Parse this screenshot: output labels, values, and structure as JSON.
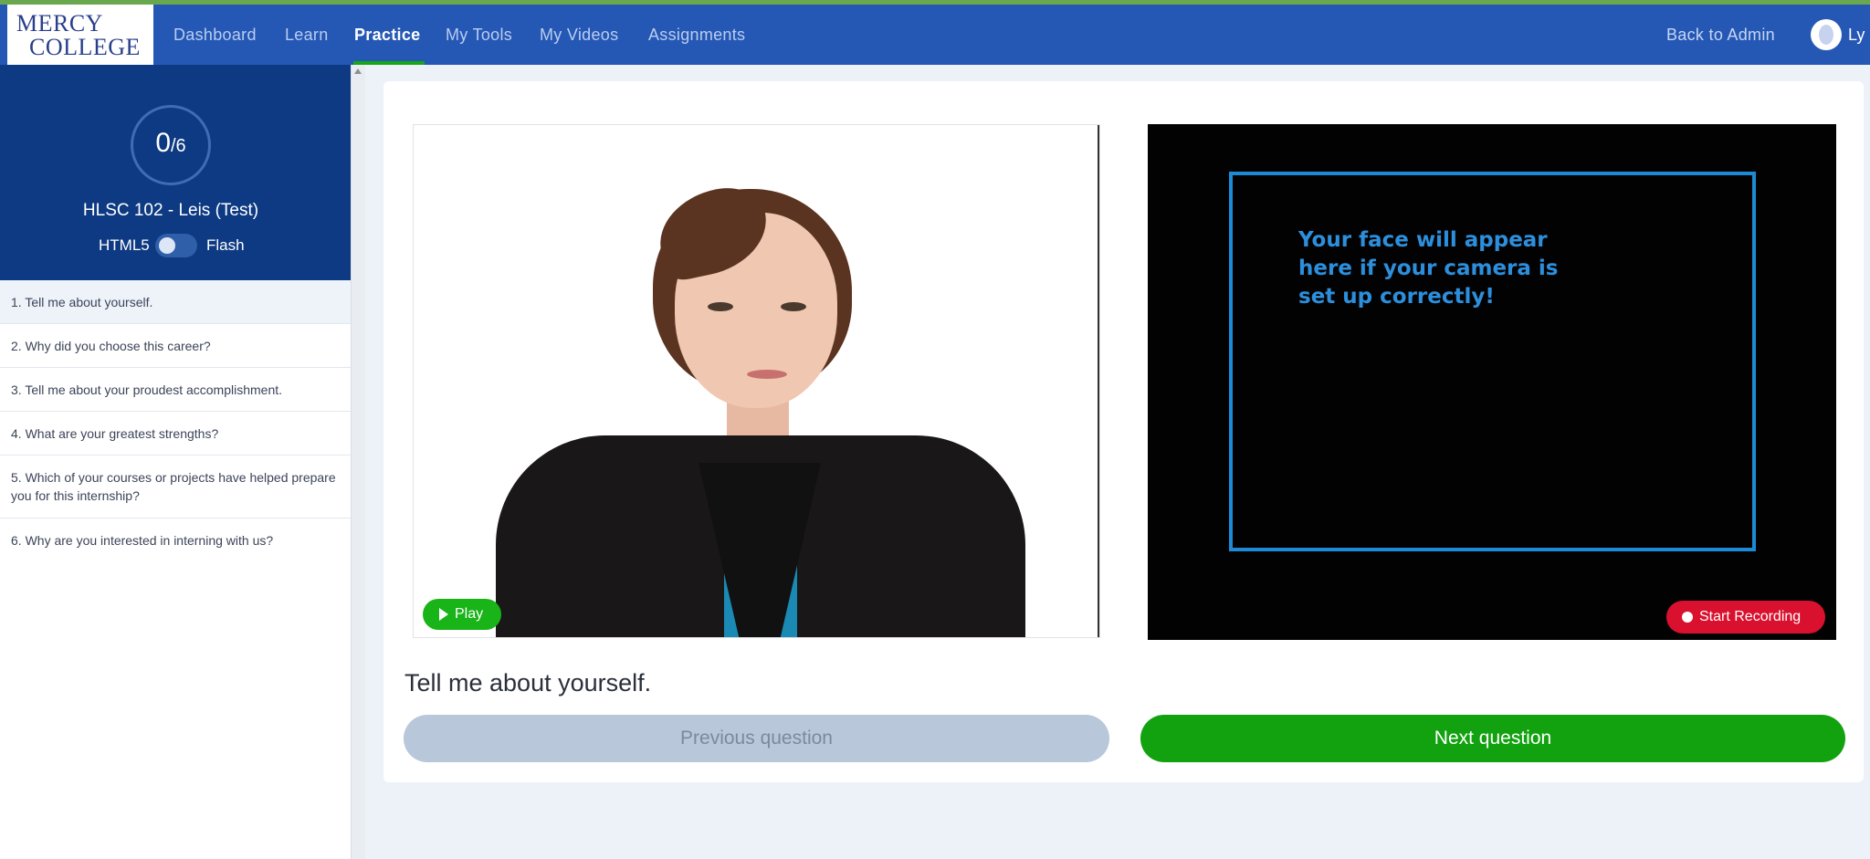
{
  "nav": {
    "logo_line1": "MERCY",
    "logo_line2": "COLLEGE",
    "links": [
      "Dashboard",
      "Learn",
      "Practice",
      "My Tools",
      "My Videos",
      "Assignments"
    ],
    "active": "Practice",
    "back_to_admin": "Back to Admin",
    "user_name": "Ly"
  },
  "sidebar": {
    "progress_value": "0",
    "progress_total": "/6",
    "course_title": "HLSC 102 - Leis (Test)",
    "toggle_left": "HTML5",
    "toggle_right": "Flash",
    "questions": [
      "1. Tell me about yourself.",
      "2. Why did you choose this career?",
      "3. Tell me about your proudest accomplishment.",
      "4. What are your greatest strengths?",
      "5. Which of your courses or projects have helped prepare you for this internship?",
      "6. Why are you interested in interning with us?"
    ]
  },
  "player": {
    "play_label": "Play"
  },
  "camera": {
    "message": "Your face will appear here if your camera is set up correctly!",
    "record_label": "Start Recording"
  },
  "main": {
    "question": "Tell me about yourself.",
    "prev_label": "Previous question",
    "next_label": "Next question"
  },
  "colors": {
    "nav_bg": "#2558b5",
    "sidebar_header": "#0d3a82",
    "accent_green": "#12a20f",
    "record_red": "#d9112f",
    "camera_blue": "#1d8ad6"
  }
}
